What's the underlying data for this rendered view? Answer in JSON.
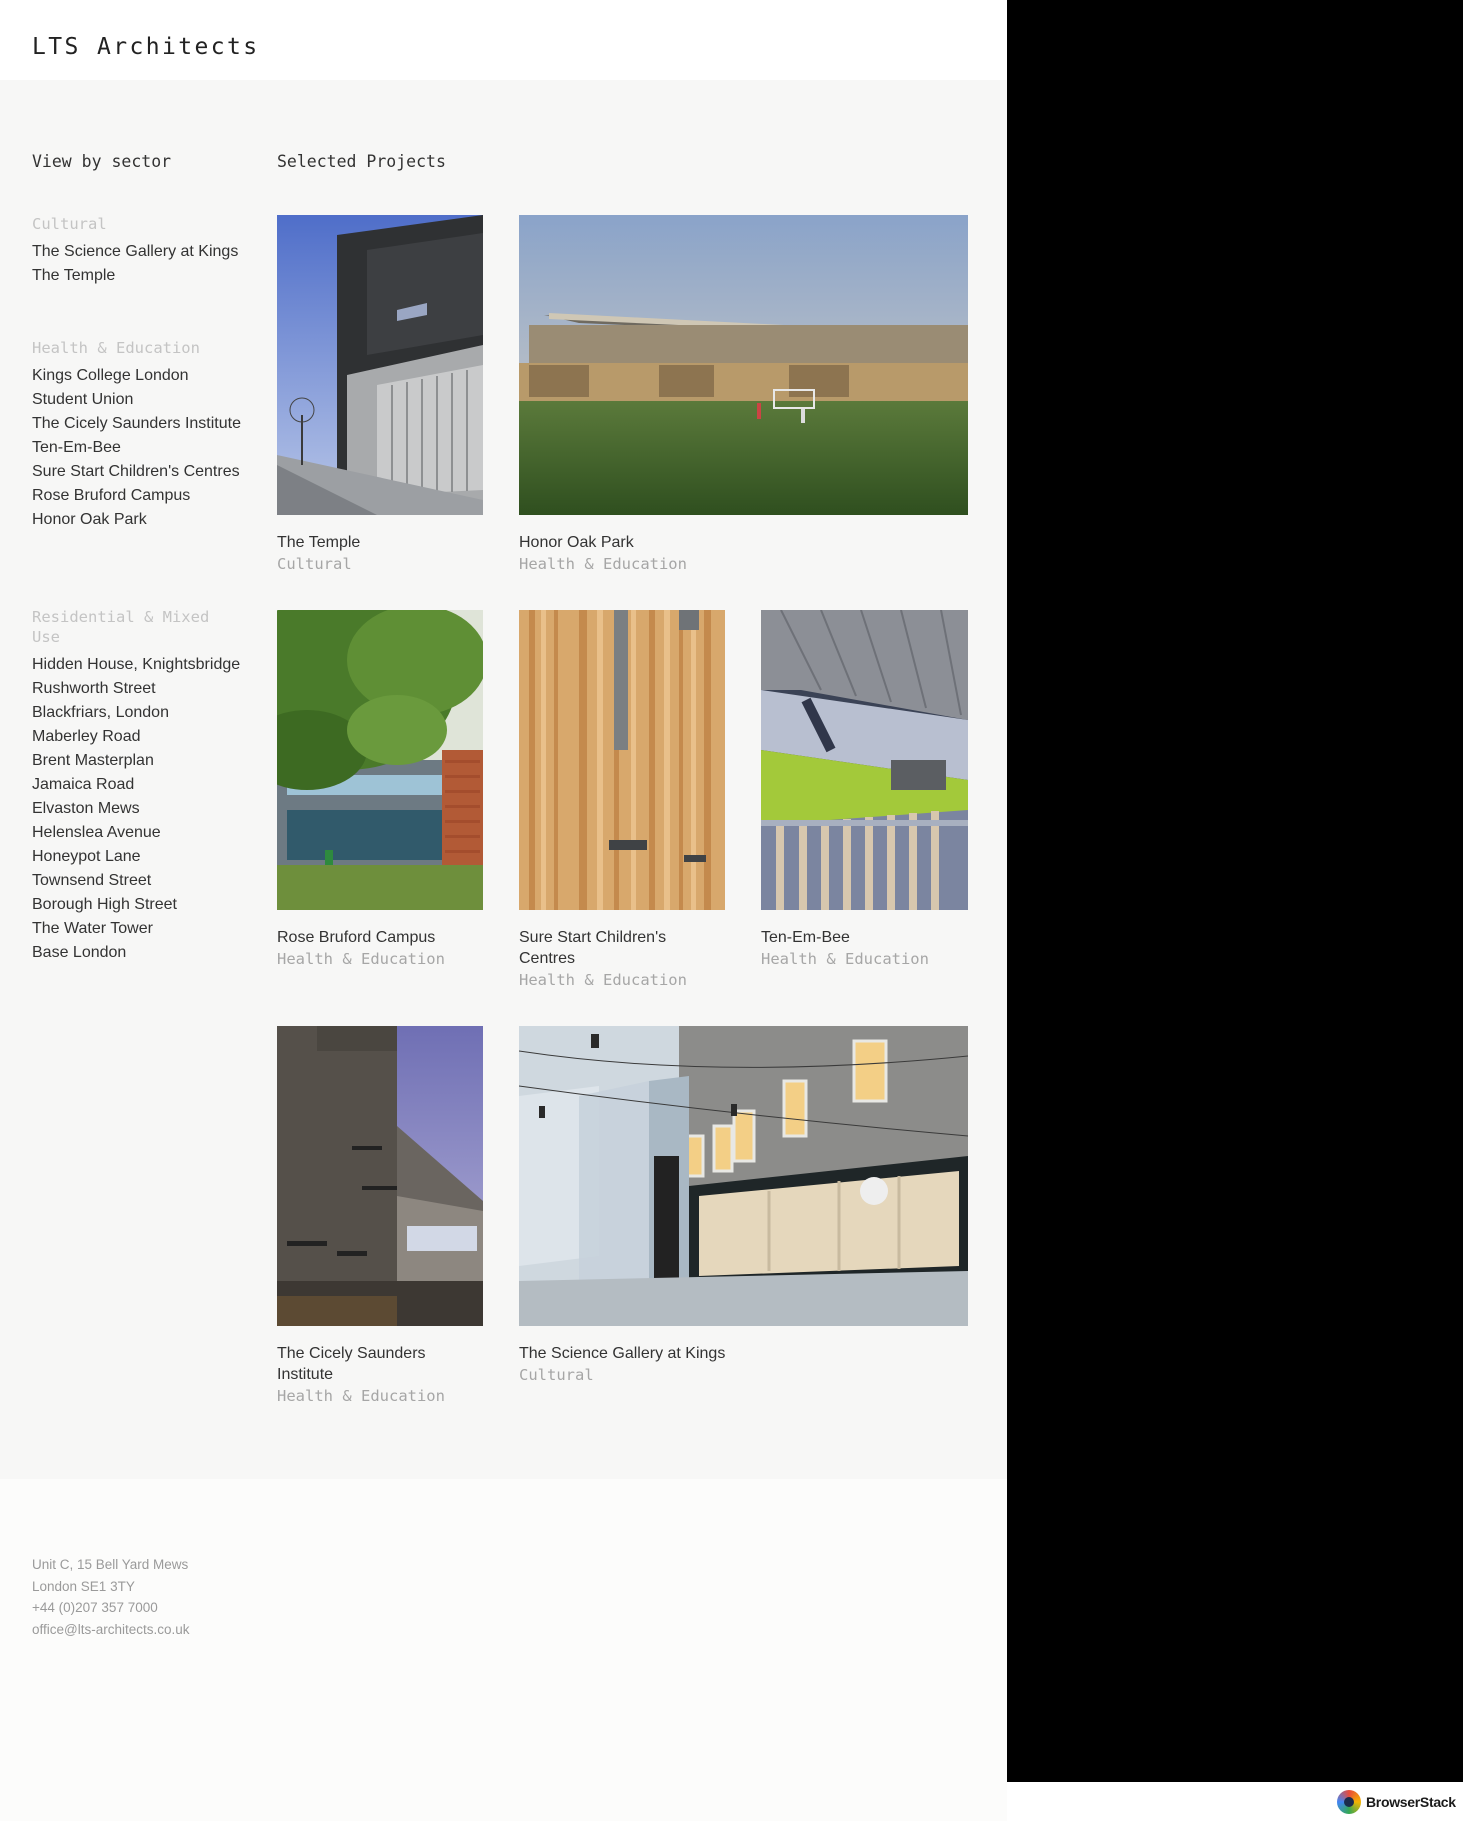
{
  "site": {
    "logo": "LTS Architects"
  },
  "sidebar": {
    "heading": "View by sector",
    "sectors": [
      {
        "title": "Cultural",
        "items": [
          "The Science Gallery at Kings",
          "The Temple"
        ]
      },
      {
        "title": "Health & Education",
        "items": [
          "Kings College London Student Union",
          "The Cicely Saunders Institute",
          "Ten-Em-Bee",
          "Sure Start Children's Centres",
          "Rose Bruford Campus",
          "Honor Oak Park"
        ]
      },
      {
        "title": "Residential & Mixed Use",
        "items": [
          "Hidden House, Knightsbridge",
          "Rushworth Street",
          "Blackfriars, London",
          "Maberley Road",
          "Brent Masterplan",
          "Jamaica Road",
          "Elvaston Mews",
          "Helenslea Avenue",
          "Honeypot Lane",
          "Townsend Street",
          "Borough High Street",
          "The Water Tower",
          "Base London"
        ]
      }
    ]
  },
  "projects": {
    "heading": "Selected Projects",
    "items": [
      {
        "name": "The Temple",
        "category": "Cultural"
      },
      {
        "name": "Honor Oak Park",
        "category": "Health & Education"
      },
      {
        "name": "Rose Bruford Campus",
        "category": "Health & Education"
      },
      {
        "name": "Sure Start Children's Centres",
        "category": "Health & Education"
      },
      {
        "name": "Ten-Em-Bee",
        "category": "Health & Education"
      },
      {
        "name": "The Cicely Saunders Institute",
        "category": "Health & Education"
      },
      {
        "name": "The Science Gallery at Kings",
        "category": "Cultural"
      }
    ]
  },
  "footer": {
    "address_line1": "Unit C, 15 Bell Yard Mews",
    "address_line2": "London SE1 3TY",
    "phone": "+44 (0)207 357 7000",
    "email": "office@lts-architects.co.uk"
  },
  "overlay": {
    "badge": "BrowserStack"
  }
}
